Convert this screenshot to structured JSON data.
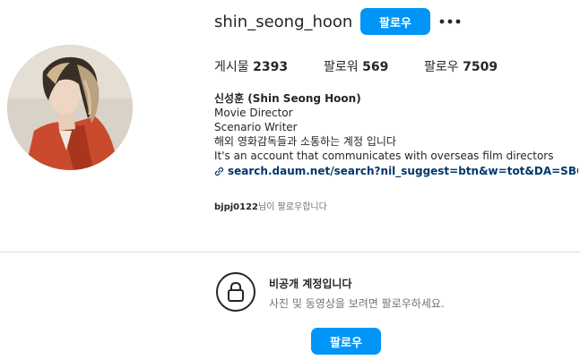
{
  "header": {
    "username": "shin_seong_hoon",
    "follow_label": "팔로우",
    "more_icon": "more-horizontal-icon"
  },
  "stats": {
    "posts_label": "게시물",
    "posts_count": "2393",
    "followers_label": "팔로워",
    "followers_count": "569",
    "following_label": "팔로우",
    "following_count": "7509"
  },
  "bio": {
    "full_name": "신성훈 (Shin Seong Hoon)",
    "lines": [
      "Movie Director",
      "Scenario Writer",
      "해외 영화감독들과 소통하는 계정 입니다",
      "It's an account that communicates with overseas film directors"
    ],
    "link_icon": "link-icon",
    "link": "search.daum.net/search?nil_suggest=btn&w=tot&DA=SBC&q=%"
  },
  "followed_by": {
    "user": "bjpj0122",
    "suffix": "님이 팔로우합니다"
  },
  "private": {
    "lock_icon": "lock-icon",
    "title": "비공개 계정입니다",
    "subtitle": "사진 및 동영상을 보려면 팔로우하세요.",
    "follow_label": "팔로우"
  },
  "colors": {
    "accent": "#0095f6",
    "link": "#00376b",
    "text": "#262626",
    "muted": "#737373",
    "divider": "#dbdbdb"
  }
}
